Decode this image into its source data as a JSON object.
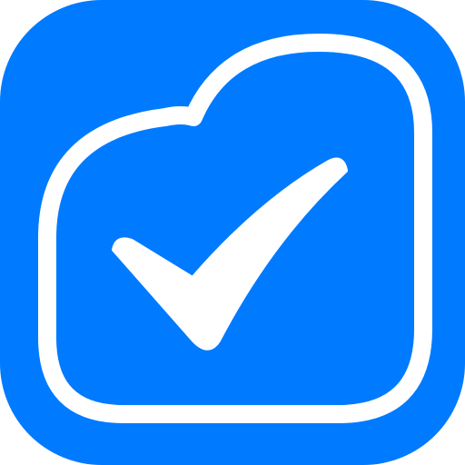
{
  "icon": {
    "name": "cloud-checkmark-app-icon",
    "background_color": "#007AFF",
    "foreground_color": "#FFFFFF",
    "symbol": "checkmark"
  }
}
